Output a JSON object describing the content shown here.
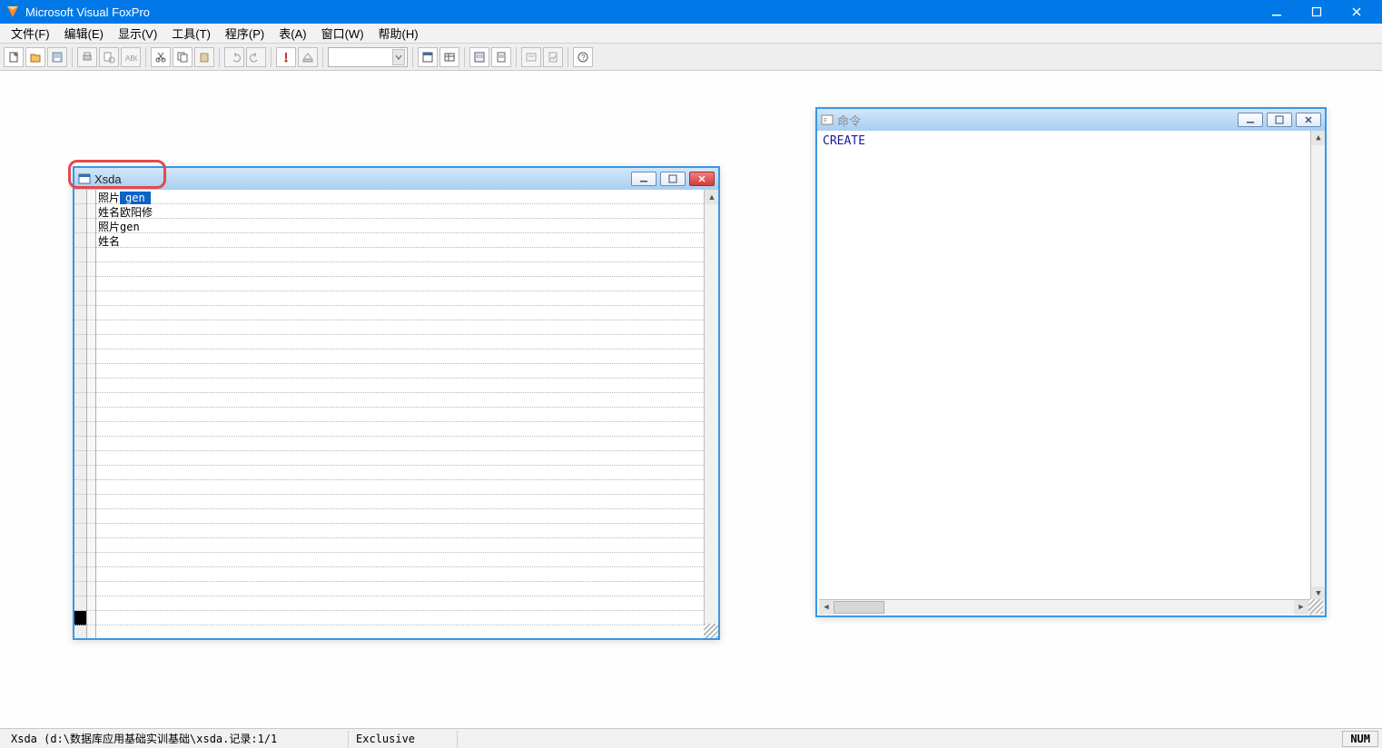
{
  "app": {
    "title": "Microsoft Visual FoxPro"
  },
  "menu": {
    "file": "文件(F)",
    "edit": "编辑(E)",
    "view": "显示(V)",
    "tools": "工具(T)",
    "program": "程序(P)",
    "table": "表(A)",
    "window": "窗口(W)",
    "help": "帮助(H)"
  },
  "browse_window": {
    "title": "Xsda",
    "rows": [
      {
        "label": "照片",
        "value": "gen",
        "selected": true
      },
      {
        "label": "姓名",
        "value": "欧阳修",
        "selected": false
      },
      {
        "label": "照片",
        "value": "gen",
        "selected": false
      },
      {
        "label": "姓名",
        "value": "",
        "selected": false
      }
    ]
  },
  "command_window": {
    "title": "命令",
    "text": "CREATE"
  },
  "status": {
    "path": "Xsda (d:\\数据库应用基础实训基础\\xsda.记录:1/1",
    "mode": "Exclusive",
    "num": "NUM"
  }
}
